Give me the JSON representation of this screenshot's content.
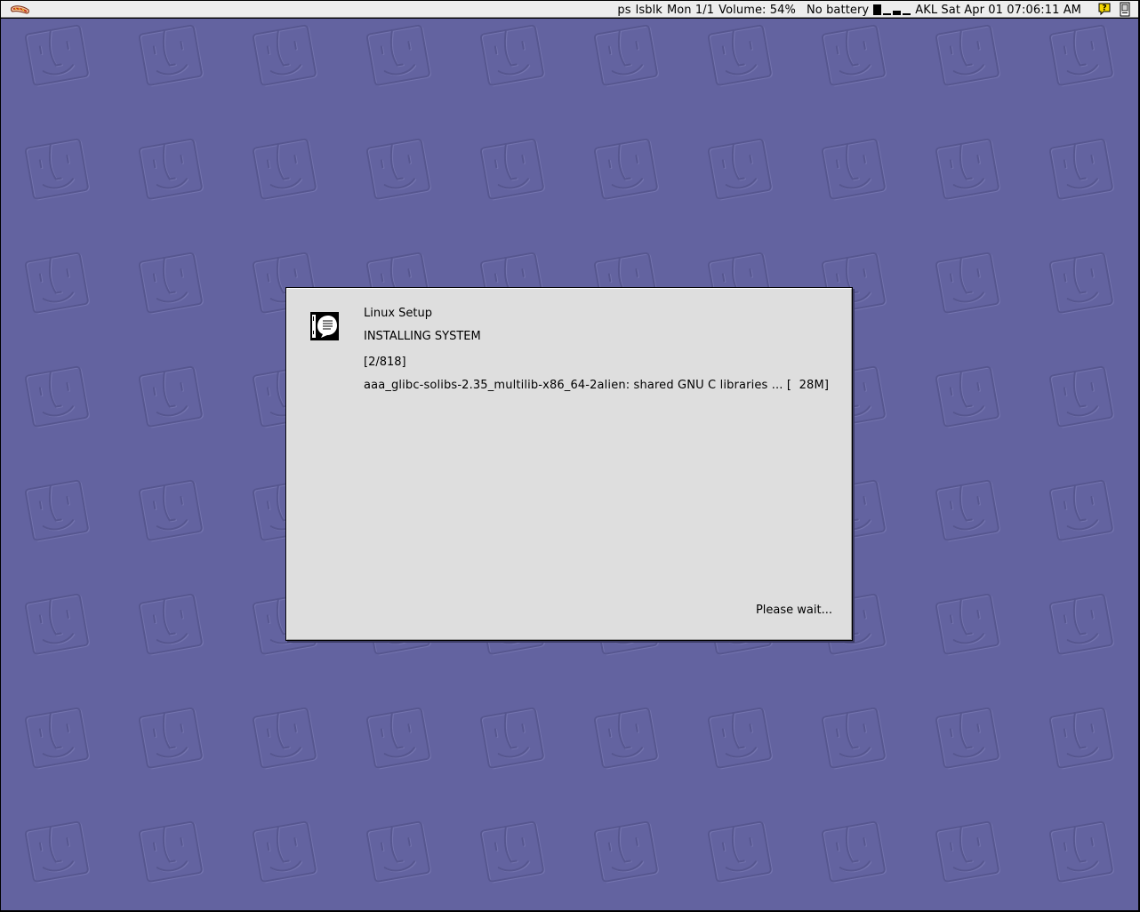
{
  "menubar": {
    "logo_icon": "hotdog-logo-icon",
    "status": {
      "program": "ps",
      "layout": "lsblk",
      "monitor": "Mon 1/1",
      "volume": "Volume: 54%",
      "battery": "No battery",
      "datetime": "AKL Sat Apr 01 07:06:11 AM"
    },
    "help_icon": "help-balloon-icon",
    "switcher_icon": "application-switcher-icon"
  },
  "desktop": {
    "background_color": "#6363a0",
    "pattern_icon": "finder-face-icon"
  },
  "dialog": {
    "icon": "setup-document-icon",
    "title": "Linux Setup",
    "heading": "INSTALLING SYSTEM",
    "counter": "[2/818]",
    "package_line": "aaa_glibc-solibs-2.35_multilib-x86_64-2alien: shared GNU C libraries ... [  28M]",
    "wait_text": "Please wait..."
  }
}
